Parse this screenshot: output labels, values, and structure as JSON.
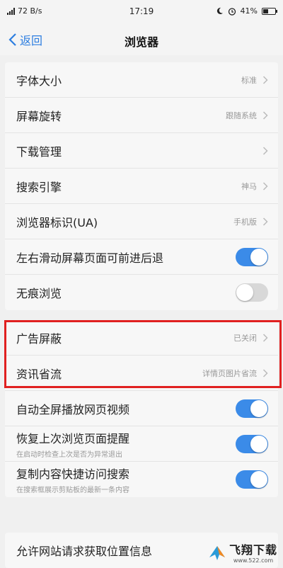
{
  "status_bar": {
    "network_speed": "72 B/s",
    "time": "17:19",
    "battery": "41%",
    "battery_level": 0.41
  },
  "navbar": {
    "back_label": "返回",
    "title": "浏览器"
  },
  "group1": [
    {
      "label": "字体大小",
      "value": "标准",
      "type": "chevron"
    },
    {
      "label": "屏幕旋转",
      "value": "跟随系统",
      "type": "chevron"
    },
    {
      "label": "下载管理",
      "value": "",
      "type": "chevron"
    },
    {
      "label": "搜索引擎",
      "value": "神马",
      "type": "chevron"
    },
    {
      "label": "浏览器标识(UA)",
      "value": "手机版",
      "type": "chevron"
    },
    {
      "label": "左右滑动屏幕页面可前进后退",
      "type": "toggle",
      "on": true
    },
    {
      "label": "无痕浏览",
      "type": "toggle",
      "on": false
    }
  ],
  "group2": [
    {
      "label": "广告屏蔽",
      "value": "已关闭",
      "type": "chevron"
    },
    {
      "label": "资讯省流",
      "value": "详情页图片省流",
      "type": "chevron"
    },
    {
      "label": "自动全屏播放网页视频",
      "type": "toggle",
      "on": true
    },
    {
      "label": "恢复上次浏览页面提醒",
      "sub": "在启动时检查上次是否为异常退出",
      "type": "toggle",
      "on": true
    },
    {
      "label": "复制内容快捷访问搜索",
      "sub": "在搜索框展示剪贴板的最新一条内容",
      "type": "toggle",
      "on": true
    }
  ],
  "group3": [
    {
      "label": "允许网站请求获取位置信息"
    }
  ],
  "watermark": {
    "main": "飞翔下载",
    "url": "www.522.com"
  },
  "colors": {
    "accent": "#3b8be8",
    "highlight": "#e02020",
    "back": "#2d7ee0"
  }
}
